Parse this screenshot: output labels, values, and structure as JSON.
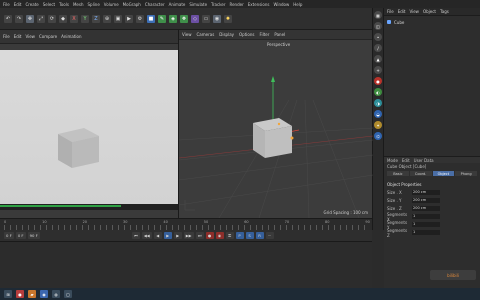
{
  "menubar": {
    "items": [
      "File",
      "Edit",
      "Create",
      "Select",
      "Tools",
      "Mesh",
      "Spline",
      "Volume",
      "MoGraph",
      "Character",
      "Animate",
      "Simulate",
      "Tracker",
      "Render",
      "Extensions",
      "Window",
      "Help"
    ]
  },
  "toolbar": {
    "buttons": [
      "undo-icon",
      "redo-icon",
      "move-icon",
      "scale-icon",
      "rotate-icon",
      "recent-icon",
      "x-axis",
      "y-axis",
      "z-axis",
      "coords-icon",
      "render-view-icon",
      "render-icon",
      "render-settings-icon",
      "cube-icon",
      "pen-icon",
      "subdivision-icon",
      "array-icon",
      "deformer-icon",
      "floor-icon",
      "camera-icon",
      "light-icon"
    ]
  },
  "picture_viewer": {
    "tabs": [
      "File",
      "Edit",
      "View",
      "Compare",
      "Animation"
    ],
    "status": "Render progress"
  },
  "viewport": {
    "menu": [
      "View",
      "Cameras",
      "Display",
      "Options",
      "Filter",
      "Panel"
    ],
    "camera_label": "Perspective",
    "footer": "Grid Spacing : 100 cm"
  },
  "timeline": {
    "ticks": [
      "0",
      "5",
      "10",
      "15",
      "20",
      "25",
      "30",
      "35",
      "40",
      "45",
      "50",
      "55",
      "60",
      "65",
      "70",
      "75",
      "80",
      "85",
      "90"
    ],
    "end_frame": "90 F"
  },
  "transport": {
    "start": "0 F",
    "current": "0 F",
    "end": "90 F"
  },
  "right_panel": {
    "menu": [
      "File",
      "Edit",
      "View",
      "Object",
      "Tags"
    ],
    "objects": [
      {
        "name": "Cube"
      }
    ],
    "attr_menu": [
      "Mode",
      "Edit",
      "User Data"
    ],
    "attr_title": "Cube Object [Cube]",
    "attr_tabs": [
      "Basic",
      "Coord.",
      "Object",
      "Phong"
    ],
    "section": "Object Properties",
    "fields": [
      {
        "label": "Size . X",
        "value": "200 cm"
      },
      {
        "label": "Size . Y",
        "value": "200 cm"
      },
      {
        "label": "Size . Z",
        "value": "200 cm"
      },
      {
        "label": "Segments X",
        "value": "1"
      },
      {
        "label": "Segments Y",
        "value": "1"
      },
      {
        "label": "Segments Z",
        "value": "1"
      }
    ]
  },
  "watermark": "bilibili"
}
